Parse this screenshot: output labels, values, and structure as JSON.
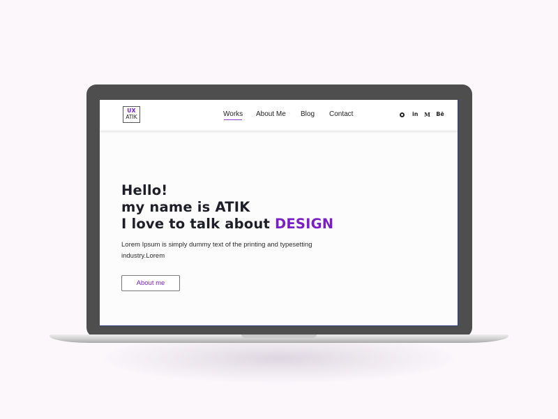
{
  "logo": {
    "top": "UX",
    "bottom": "ATIK"
  },
  "nav": {
    "items": [
      {
        "label": "Works",
        "active": true
      },
      {
        "label": "About Me"
      },
      {
        "label": "Blog"
      },
      {
        "label": "Contact"
      }
    ]
  },
  "social": {
    "icons": [
      "github-icon",
      "linkedin-icon",
      "medium-icon",
      "behance-icon"
    ],
    "linkedin": "in",
    "medium": "M",
    "behance": "Bē"
  },
  "hero": {
    "line1": "Hello!",
    "line2": "my name is ATIK",
    "line3_prefix": "I love to talk about ",
    "line3_accent": "DESIGN",
    "description": "Lorem Ipsum is simply dummy text of the printing and typesetting industry.Lorem",
    "button": "About me"
  },
  "colors": {
    "accent": "#7a1fc4",
    "background": "#fbf7fb",
    "laptop_frame": "#4e4e4e"
  }
}
